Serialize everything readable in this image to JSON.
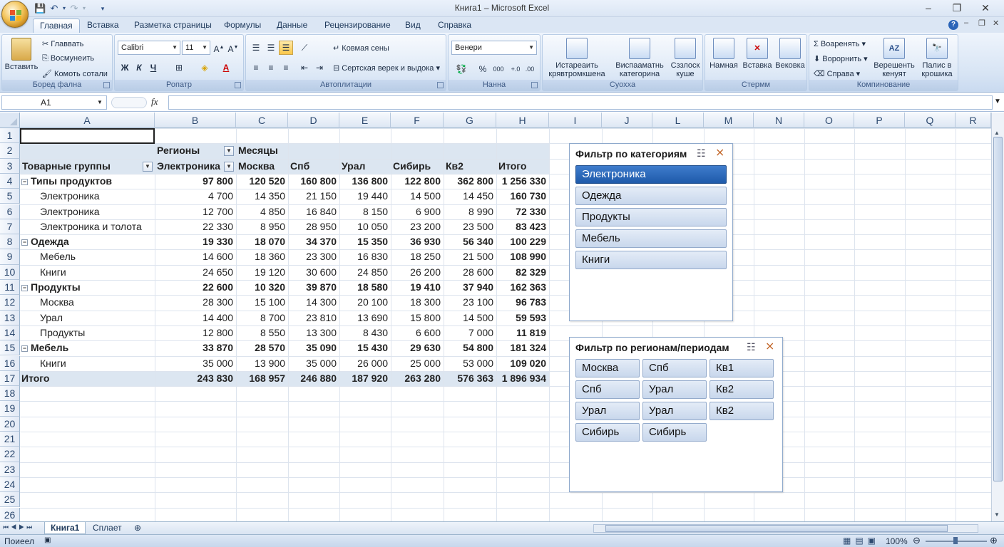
{
  "window": {
    "title": "Книга1 – Microsoft Excel",
    "minimize": "–",
    "restore": "❐",
    "close": "✕"
  },
  "tabs": [
    "Главная",
    "Вставка",
    "Разметка страницы",
    "Формулы",
    "Данные",
    "Рецензирование",
    "Вид",
    "Справка"
  ],
  "ribbon": {
    "clipboard": {
      "paste": "Вставить",
      "cut": "Главвать",
      "copy": "Восмунеить",
      "format": "Комоть сотали",
      "label": "Боред фална"
    },
    "font": {
      "name": "Calibri",
      "size": "11",
      "bold": "Ж",
      "italic": "К",
      "underline": "Ч",
      "label": "Ропатр"
    },
    "align": {
      "wrap": "Ковмая сены",
      "merge": "Сертская верек и выдока",
      "label": "Автоплитации"
    },
    "number": {
      "format": "Венери",
      "percent": "%",
      "thousands": "000",
      "label": "Нанна"
    },
    "styles": {
      "cond": [
        "Истареаить",
        "крявтромкшена"
      ],
      "table": [
        "Виспааматнь",
        "категорина"
      ],
      "cell": [
        "Сззлоск",
        "кушe"
      ],
      "label": "Суохха"
    },
    "cells": {
      "insert": "Намная",
      "delete": "Вставка",
      "format": "Вековка",
      "label": "Стермм"
    },
    "editing": {
      "sum": "Σ Воаренять",
      "fill": "Ворорнить",
      "clear": "Справа",
      "sort": [
        "Верешенть",
        "кенуят"
      ],
      "find": [
        "Палис в",
        "крошика"
      ],
      "label": "Компинование"
    }
  },
  "formula_bar": {
    "name_box": "A1",
    "fx": "fx",
    "value": ""
  },
  "columns": [
    "A",
    "B",
    "C",
    "D",
    "E",
    "F",
    "G",
    "H",
    "I",
    "J",
    "L",
    "M",
    "N",
    "O",
    "P",
    "Q",
    "R"
  ],
  "rows": [
    "1",
    "2",
    "3",
    "4",
    "5",
    "6",
    "7",
    "8",
    "9",
    "10",
    "11",
    "12",
    "13",
    "14",
    "15",
    "16",
    "17",
    "18",
    "19",
    "20",
    "21",
    "22",
    "23",
    "24",
    "25",
    "26"
  ],
  "pivot": {
    "col_field": "Регионы",
    "col_field2": "Месяцы",
    "row_field": "Товарные группы",
    "header": [
      "Электроника",
      "Москва",
      "Спб",
      "Урал",
      "Сибирь",
      "Кв2",
      "Итого"
    ],
    "body": [
      {
        "label": "Типы продуктов",
        "level": 0,
        "vals": [
          "97 800",
          "120 520",
          "160 800",
          "136 800",
          "122 800",
          "362 800",
          "1 256 330"
        ]
      },
      {
        "label": "Электроника",
        "level": 1,
        "vals": [
          "4 700",
          "14 350",
          "21 150",
          "19 440",
          "14 500",
          "14 450",
          "160 730"
        ]
      },
      {
        "label": "Электроника",
        "level": 1,
        "vals": [
          "12 700",
          "4 850",
          "16 840",
          "8 150",
          "6 900",
          "8 990",
          "72 330"
        ]
      },
      {
        "label": "Электроника и толота",
        "level": 1,
        "vals": [
          "22 330",
          "8 950",
          "28 950",
          "10 050",
          "23 200",
          "23 500",
          "83 423"
        ]
      },
      {
        "label": "Одежда",
        "level": 0,
        "vals": [
          "19 330",
          "18 070",
          "34 370",
          "15 350",
          "36 930",
          "56 340",
          "100 229"
        ]
      },
      {
        "label": "Мебель",
        "level": 1,
        "vals": [
          "14 600",
          "18 360",
          "23 300",
          "16 830",
          "18 250",
          "21 500",
          "108 990"
        ]
      },
      {
        "label": "Книги",
        "level": 1,
        "vals": [
          "24 650",
          "19 120",
          "30 600",
          "24 850",
          "26 200",
          "28 600",
          "82 329"
        ]
      },
      {
        "label": "Продукты",
        "level": 0,
        "vals": [
          "22 600",
          "10 320",
          "39 870",
          "18 580",
          "19 410",
          "37 940",
          "162 363"
        ]
      },
      {
        "label": "Москва",
        "level": 1,
        "vals": [
          "28 300",
          "15 100",
          "14 300",
          "20 100",
          "18 300",
          "23 100",
          "96 783"
        ]
      },
      {
        "label": "Урал",
        "level": 1,
        "vals": [
          "14 400",
          "8 700",
          "23 810",
          "13 690",
          "15 800",
          "14 500",
          "59 593"
        ]
      },
      {
        "label": "Продукты",
        "level": 1,
        "vals": [
          "12 800",
          "8 550",
          "13 300",
          "8 430",
          "6 600",
          "7 000",
          "11 819"
        ]
      },
      {
        "label": "Мебель",
        "level": 0,
        "vals": [
          "33 870",
          "28 570",
          "35 090",
          "15 430",
          "29 630",
          "54 800",
          "181 324"
        ]
      },
      {
        "label": "Книги",
        "level": 1,
        "vals": [
          "35 000",
          "13 900",
          "35 000",
          "26 000",
          "25 000",
          "53 000",
          "109 020"
        ]
      },
      {
        "label": "Итого",
        "level": 2,
        "vals": [
          "243 830",
          "168 957",
          "246 880",
          "187 920",
          "263 280",
          "576 363",
          "1 896 934"
        ]
      }
    ]
  },
  "slicer1": {
    "title": "Фильтр по категориям",
    "items": [
      "Электроника",
      "Одежда",
      "Продукты",
      "Мебель",
      "Книги"
    ],
    "selected": "Электроника"
  },
  "slicer2": {
    "title": "Фильтр по регионам/периодам",
    "items": [
      "Москва",
      "Спб",
      "Кв1",
      "Спб",
      "Урал",
      "Кв2",
      "Урал",
      "Урал",
      "Кв2",
      "Сибирь",
      "Сибирь"
    ]
  },
  "sheets": [
    "Книга1",
    "Сплает"
  ],
  "status": {
    "mode": "Поиеел",
    "zoom": "100%"
  },
  "colors": {
    "accent": "#1e5aaa",
    "pivot_header": "#dce6f1",
    "ribbon": "#dbe6f4"
  }
}
